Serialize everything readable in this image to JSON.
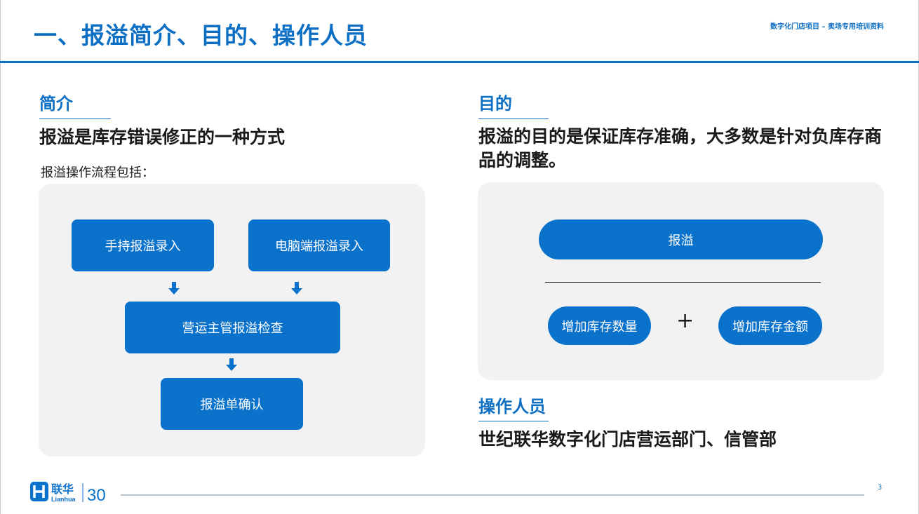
{
  "header": {
    "title": "一、报溢简介、目的、操作人员",
    "project_tag": "数字化门店项目 – 卖场专用培训资料"
  },
  "intro": {
    "section_title": "简介",
    "heading": "报溢是库存错误修正的一种方式",
    "flow_label": "报溢操作流程包括：",
    "flow": {
      "step_handheld": "手持报溢录入",
      "step_pc": "电脑端报溢录入",
      "step_check": "营运主管报溢检查",
      "step_confirm": "报溢单确认"
    }
  },
  "purpose": {
    "section_title": "目的",
    "heading": "报溢的目的是保证库存准确，大多数是针对负库存商品的调整。",
    "diagram": {
      "top": "报溢",
      "left": "增加库存数量",
      "operator": "+",
      "right": "增加库存金额"
    }
  },
  "staff": {
    "section_title": "操作人员",
    "text": "世纪联华数字化门店营运部门、信管部"
  },
  "footer": {
    "logo_cn": "联华",
    "logo_en": "Lianhua",
    "logo_number": "30",
    "page_number": "3"
  },
  "colors": {
    "brand_blue": "#0d6fc4",
    "box_blue": "#0b72cc",
    "panel_grey": "#f2f2f2"
  },
  "icons": [
    "down-arrow-icon",
    "lianhua-logo-icon"
  ]
}
